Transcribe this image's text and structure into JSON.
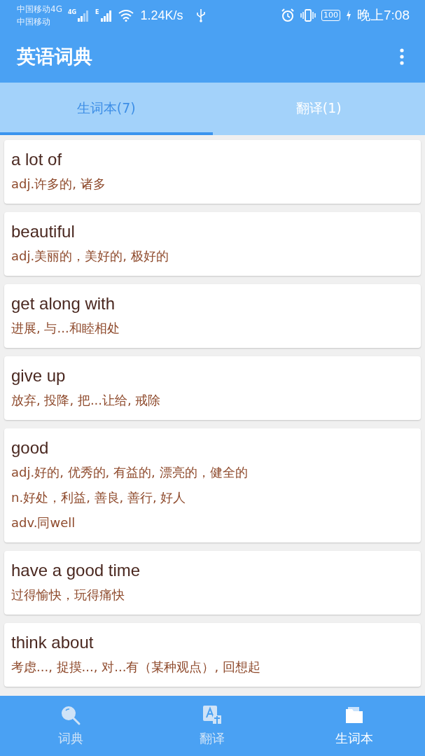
{
  "status_bar": {
    "carrier_1": "中国移动4G",
    "carrier_2": "中国移动",
    "net_1": "4G",
    "net_2": "E",
    "speed": "1.24K/s",
    "battery": "100",
    "time": "晚上7:08"
  },
  "app_bar": {
    "title": "英语词典"
  },
  "tabs": [
    {
      "label": "生词本(7)",
      "selected": true
    },
    {
      "label": "翻译(1)",
      "selected": false
    }
  ],
  "words": [
    {
      "word": "a lot of",
      "meanings": [
        "adj.许多的, 诸多"
      ]
    },
    {
      "word": "beautiful",
      "meanings": [
        "adj.美丽的，美好的, 极好的"
      ]
    },
    {
      "word": "get along with",
      "meanings": [
        "进展, 与...和睦相处"
      ]
    },
    {
      "word": "give up",
      "meanings": [
        "放弃, 投降, 把...让给, 戒除"
      ]
    },
    {
      "word": "good",
      "meanings": [
        "adj.好的, 优秀的, 有益的, 漂亮的，健全的",
        "n.好处，利益, 善良, 善行, 好人",
        "adv.同well"
      ]
    },
    {
      "word": "have a good time",
      "meanings": [
        "过得愉快，玩得痛快"
      ]
    },
    {
      "word": "think about",
      "meanings": [
        "考虑..., 捉摸..., 对...有（某种观点）, 回想起"
      ]
    }
  ],
  "bottom_nav": [
    {
      "kind": "search",
      "label": "词典",
      "selected": false
    },
    {
      "kind": "translate",
      "label": "翻译",
      "selected": false
    },
    {
      "kind": "book",
      "label": "生词本",
      "selected": true
    }
  ]
}
